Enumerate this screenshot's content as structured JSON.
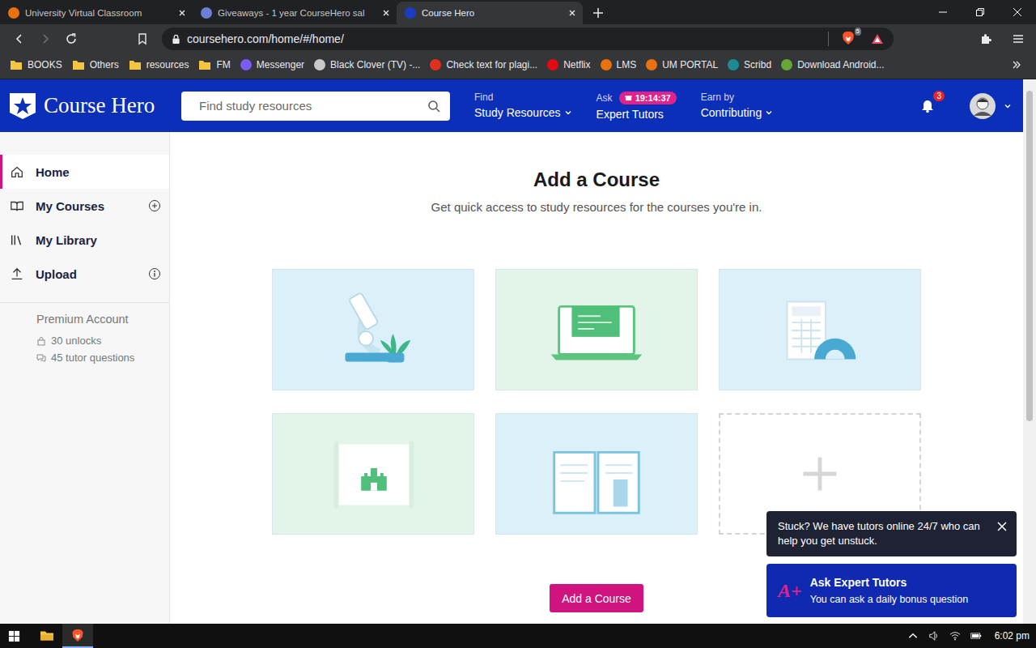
{
  "browser": {
    "tabs": [
      {
        "label": "University Virtual Classroom",
        "selected": false,
        "color": "#e8730c"
      },
      {
        "label": "Giveaways - 1 year CourseHero sal",
        "selected": false,
        "color": "#6b7fd7"
      },
      {
        "label": "Course Hero",
        "selected": true,
        "color": "#1b3bc0"
      }
    ],
    "nav_buttons": {
      "back_enabled": true,
      "forward_enabled": false
    },
    "url": "coursehero.com/home/#/home/",
    "shields_count": "5",
    "bookmarks": [
      {
        "label": "BOOKS",
        "kind": "folder"
      },
      {
        "label": "Others",
        "kind": "folder"
      },
      {
        "label": "resources",
        "kind": "folder"
      },
      {
        "label": "FM",
        "kind": "folder"
      },
      {
        "label": "Messenger",
        "kind": "site",
        "color": "#7b5cf5"
      },
      {
        "label": "Black Clover (TV) -...",
        "kind": "site",
        "color": "#c9c9c9"
      },
      {
        "label": "Check text for plagi...",
        "kind": "site",
        "color": "#e0301e"
      },
      {
        "label": "Netflix",
        "kind": "site",
        "color": "#e50914"
      },
      {
        "label": "LMS",
        "kind": "site",
        "color": "#e8730c"
      },
      {
        "label": "UM PORTAL",
        "kind": "site",
        "color": "#e8730c"
      },
      {
        "label": "Scribd",
        "kind": "site",
        "color": "#1e8a95"
      },
      {
        "label": "Download Android...",
        "kind": "site",
        "color": "#6aa636"
      }
    ]
  },
  "header": {
    "logo": "Course Hero",
    "search_placeholder": "Find study resources",
    "nav": [
      {
        "top": "Find",
        "bottom": "Study Resources",
        "dropdown": true
      },
      {
        "top": "Ask",
        "badge": "19:14:37",
        "bottom": "Expert Tutors",
        "dropdown": false
      },
      {
        "top": "Earn by",
        "bottom": "Contributing",
        "dropdown": true
      }
    ],
    "notifications": "3"
  },
  "sidebar": {
    "items": [
      {
        "label": "Home",
        "selected": true,
        "kind": "plain"
      },
      {
        "label": "My Courses",
        "selected": false,
        "kind": "add"
      },
      {
        "label": "My Library",
        "selected": false,
        "kind": "plain"
      },
      {
        "label": "Upload",
        "selected": false,
        "kind": "info"
      }
    ],
    "account": {
      "title": "Premium Account",
      "stats": [
        "30 unlocks",
        "45 tutor questions"
      ]
    }
  },
  "main": {
    "title": "Add a Course",
    "subtitle": "Get quick access to study resources for the courses you're in.",
    "cards": [
      {
        "kind": "microscope",
        "color": "#dcf0fa"
      },
      {
        "kind": "laptop",
        "color": "#e3f5e8"
      },
      {
        "kind": "calculator",
        "color": "#dcf0fa"
      },
      {
        "kind": "map",
        "color": "#e3f5e8"
      },
      {
        "kind": "book",
        "color": "#dcf0fa"
      },
      {
        "kind": "add",
        "color": "#ffffff"
      }
    ],
    "button": "Add a Course"
  },
  "toasts": {
    "message": "Stuck? We have tutors online 24/7 who can help you get unstuck.",
    "promo_icon": "A+",
    "promo_title": "Ask Expert Tutors",
    "promo_text": "You can ask a daily bonus question"
  },
  "scrollbar": {
    "level": 0.62
  },
  "taskbar": {
    "apps": [
      {
        "kind": "explorer",
        "active": false
      },
      {
        "kind": "brave",
        "active": true
      }
    ],
    "clock": "6:02 pm"
  }
}
